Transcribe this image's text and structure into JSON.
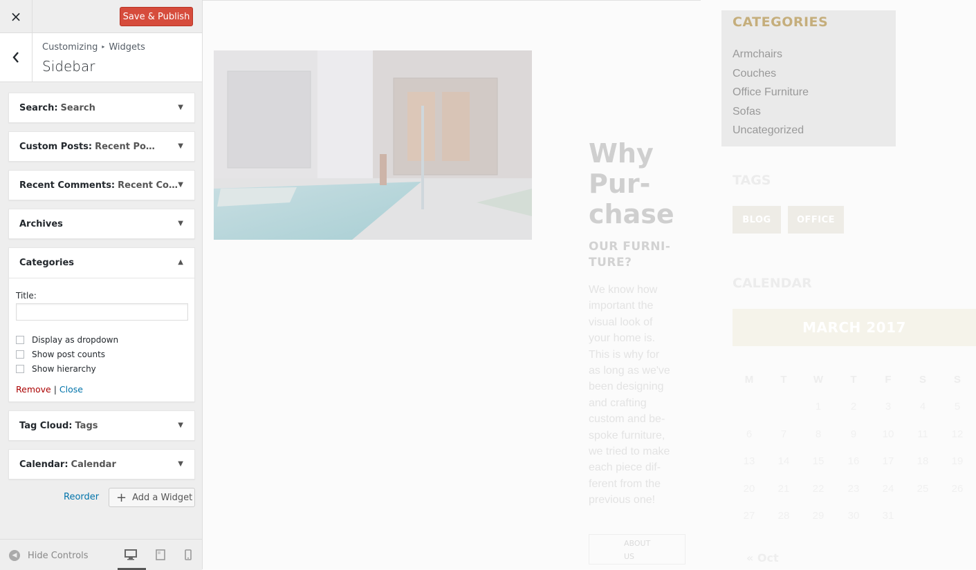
{
  "panel": {
    "close_icon": "×",
    "save_label": "Save & Publish",
    "breadcrumb": [
      "Customizing",
      "Widgets"
    ],
    "breadcrumb_sep": "▸",
    "title": "Sidebar",
    "widgets": [
      {
        "name": "Search:",
        "sub": "Search"
      },
      {
        "name": "Custom Posts:",
        "sub": "Recent Posts"
      },
      {
        "name": "Recent Comments:",
        "sub": "Recent Com..."
      },
      {
        "name": "Archives",
        "sub": ""
      },
      {
        "name": "Categories",
        "sub": ""
      },
      {
        "name": "Tag Cloud:",
        "sub": "Tags"
      },
      {
        "name": "Calendar:",
        "sub": "Calendar"
      }
    ],
    "categories_form": {
      "title_label": "Title:",
      "title_value": "",
      "checkboxes": [
        "Display as dropdown",
        "Show post counts",
        "Show hierarchy"
      ],
      "remove": "Remove",
      "separator": "|",
      "close": "Close"
    },
    "reorder": "Reorder",
    "add_widget": "Add a Widget",
    "hide_controls": "Hide Controls",
    "colors": {
      "accent": "#0073aa",
      "save": "#d64c3c",
      "remove": "#aa0000"
    }
  },
  "preview": {
    "why_lines": [
      "Why",
      "Pur-",
      "chase"
    ],
    "our_furniture_lines": [
      "OUR FURNI-",
      "TURE?"
    ],
    "body_lines": [
      "We know how",
      "important the",
      "visual look of",
      "your home is.",
      "This is why for",
      "as long as we've",
      "been designing",
      "and crafting",
      "custom and be-",
      "spoke furniture,",
      "we tried to make",
      "each piece dif-",
      "ferent from the",
      "previous one!"
    ],
    "about_lines": [
      "ABOUT",
      "US"
    ],
    "categories_heading": "CATEGORIES",
    "categories": [
      "Armchairs",
      "Couches",
      "Office Furniture",
      "Sofas",
      "Uncategorized"
    ],
    "tags_heading": "TAGS",
    "tags": [
      "BLOG",
      "OFFICE"
    ],
    "calendar_heading": "CALENDAR",
    "calendar_month": "MARCH 2017",
    "calendar_dow": [
      "M",
      "T",
      "W",
      "T",
      "F",
      "S",
      "S"
    ],
    "calendar_weeks": [
      [
        "",
        "",
        "1",
        "2",
        "3",
        "4",
        "5"
      ],
      [
        "6",
        "7",
        "8",
        "9",
        "10",
        "11",
        "12"
      ],
      [
        "13",
        "14",
        "15",
        "16",
        "17",
        "18",
        "19"
      ],
      [
        "20",
        "21",
        "22",
        "23",
        "24",
        "25",
        "26"
      ],
      [
        "27",
        "28",
        "29",
        "30",
        "31",
        "",
        ""
      ]
    ],
    "calendar_prev": "« Oct",
    "colors": {
      "heading_gold": "#c5ae7c"
    }
  }
}
